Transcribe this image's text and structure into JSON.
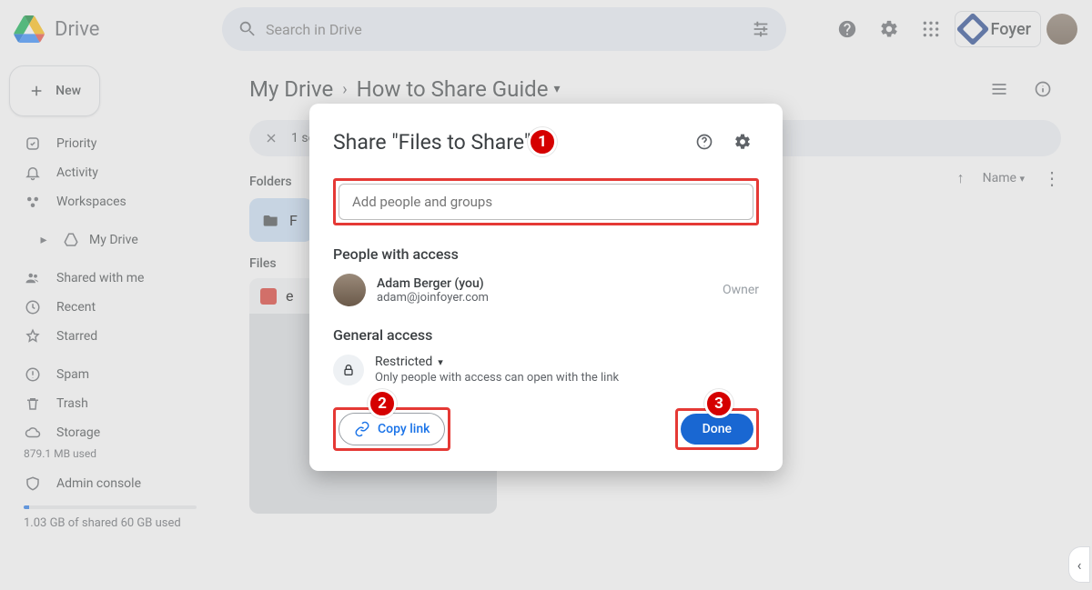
{
  "app": {
    "name": "Drive"
  },
  "search": {
    "placeholder": "Search in Drive"
  },
  "foyer": {
    "label": "Foyer"
  },
  "new_button": {
    "label": "New"
  },
  "sidebar": {
    "priority": "Priority",
    "activity": "Activity",
    "workspaces": "Workspaces",
    "my_drive": "My Drive",
    "shared": "Shared with me",
    "recent": "Recent",
    "starred": "Starred",
    "spam": "Spam",
    "trash": "Trash",
    "storage": "Storage",
    "mb_used": "879.1 MB used",
    "admin": "Admin console",
    "storage_text": "1.03 GB of shared 60 GB used"
  },
  "breadcrumb": {
    "root": "My Drive",
    "current": "How to Share Guide"
  },
  "selection": {
    "text": "1 se"
  },
  "sections": {
    "folders": "Folders",
    "files": "Files"
  },
  "sort": {
    "label": "Name"
  },
  "folder": {
    "name_partial": "F"
  },
  "file": {
    "name_partial": "e"
  },
  "modal": {
    "title": "Share \"Files to Share\"",
    "add_placeholder": "Add people and groups",
    "people_heading": "People with access",
    "person": {
      "name": "Adam Berger (you)",
      "email": "adam@joinfoyer.com",
      "role": "Owner"
    },
    "general_heading": "General access",
    "restricted": "Restricted",
    "restricted_sub": "Only people with access can open with the link",
    "copy": "Copy link",
    "done": "Done"
  },
  "badges": {
    "b1": "1",
    "b2": "2",
    "b3": "3"
  }
}
